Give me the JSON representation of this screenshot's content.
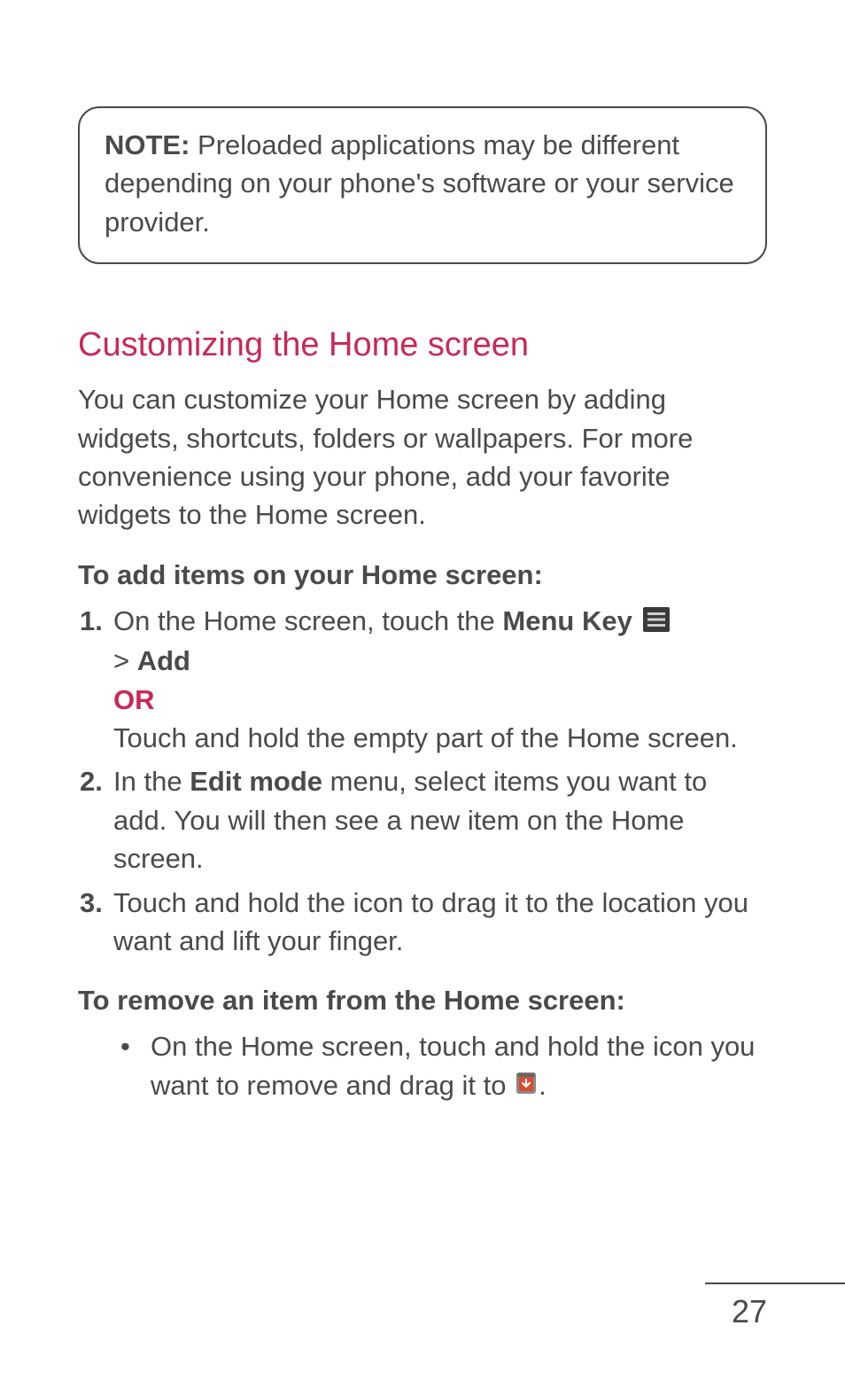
{
  "note": {
    "label": "NOTE:",
    "text": " Preloaded applications may be different depending on your phone's software or your service provider."
  },
  "section_heading": "Customizing the Home screen",
  "intro": "You can customize your Home screen by adding widgets, shortcuts, folders or wallpapers. For more convenience using your phone, add your favorite widgets to the Home screen.",
  "add_heading": "To add items on your Home screen:",
  "steps": [
    {
      "num": "1.",
      "pre": " On the Home screen, touch the ",
      "bold1": "Menu Key",
      "line2_pre": " > ",
      "bold2": "Add",
      "or": "OR",
      "tail": "Touch and hold the empty part of the Home screen."
    },
    {
      "num": "2.",
      "pre": "In the ",
      "bold1": "Edit mode",
      "post": " menu, select items you want to add. You will then see a new item on the Home screen."
    },
    {
      "num": "3.",
      "text": "Touch and hold the icon to drag it to the location you want and lift your finger."
    }
  ],
  "remove_heading": "To remove an item from the Home screen:",
  "bullet": {
    "dot": "•",
    "pre": " On the Home screen, touch and hold the icon you want to remove and drag it to ",
    "post": "."
  },
  "page_number": "27"
}
